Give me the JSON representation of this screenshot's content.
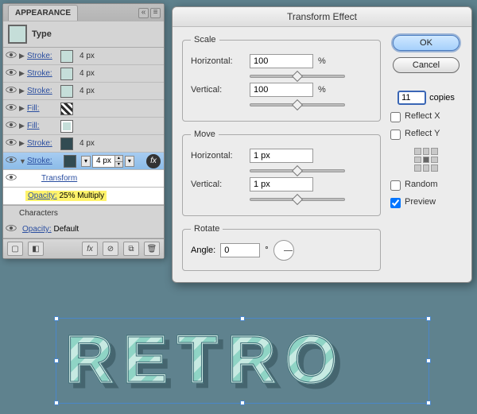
{
  "appearance": {
    "panel_title": "APPEARANCE",
    "type_label": "Type",
    "rows": [
      {
        "label": "Stroke:",
        "value": "4 px",
        "swatch": "#c5ded9"
      },
      {
        "label": "Stroke:",
        "value": "4 px",
        "swatch": "#c5ded9"
      },
      {
        "label": "Stroke:",
        "value": "4 px",
        "swatch": "#c5ded9"
      },
      {
        "label": "Fill:",
        "value": "",
        "swatch": "pattern"
      },
      {
        "label": "Fill:",
        "value": "",
        "swatch": "#c5ded9"
      },
      {
        "label": "Stroke:",
        "value": "4 px",
        "swatch": "#324b52"
      },
      {
        "label": "Stroke:",
        "value": "4 px",
        "swatch": "#324b52",
        "selected": true
      }
    ],
    "sub_transform": "Transform",
    "sub_opacity_label": "Opacity:",
    "sub_opacity_value": "25% Multiply",
    "characters_label": "Characters",
    "default_opacity_label": "Opacity:",
    "default_opacity_value": "Default"
  },
  "dialog": {
    "title": "Transform Effect",
    "scale": {
      "legend": "Scale",
      "horizontal_label": "Horizontal:",
      "horizontal_value": "100",
      "vertical_label": "Vertical:",
      "vertical_value": "100",
      "unit": "%"
    },
    "move": {
      "legend": "Move",
      "horizontal_label": "Horizontal:",
      "horizontal_value": "1 px",
      "vertical_label": "Vertical:",
      "vertical_value": "1 px"
    },
    "rotate": {
      "legend": "Rotate",
      "angle_label": "Angle:",
      "angle_value": "0",
      "unit": "°"
    },
    "ok_label": "OK",
    "cancel_label": "Cancel",
    "copies_value": "11",
    "copies_label": "copies",
    "reflect_x_label": "Reflect X",
    "reflect_y_label": "Reflect Y",
    "random_label": "Random",
    "preview_label": "Preview",
    "preview_checked": true
  },
  "artwork": {
    "text": "RETRO"
  }
}
